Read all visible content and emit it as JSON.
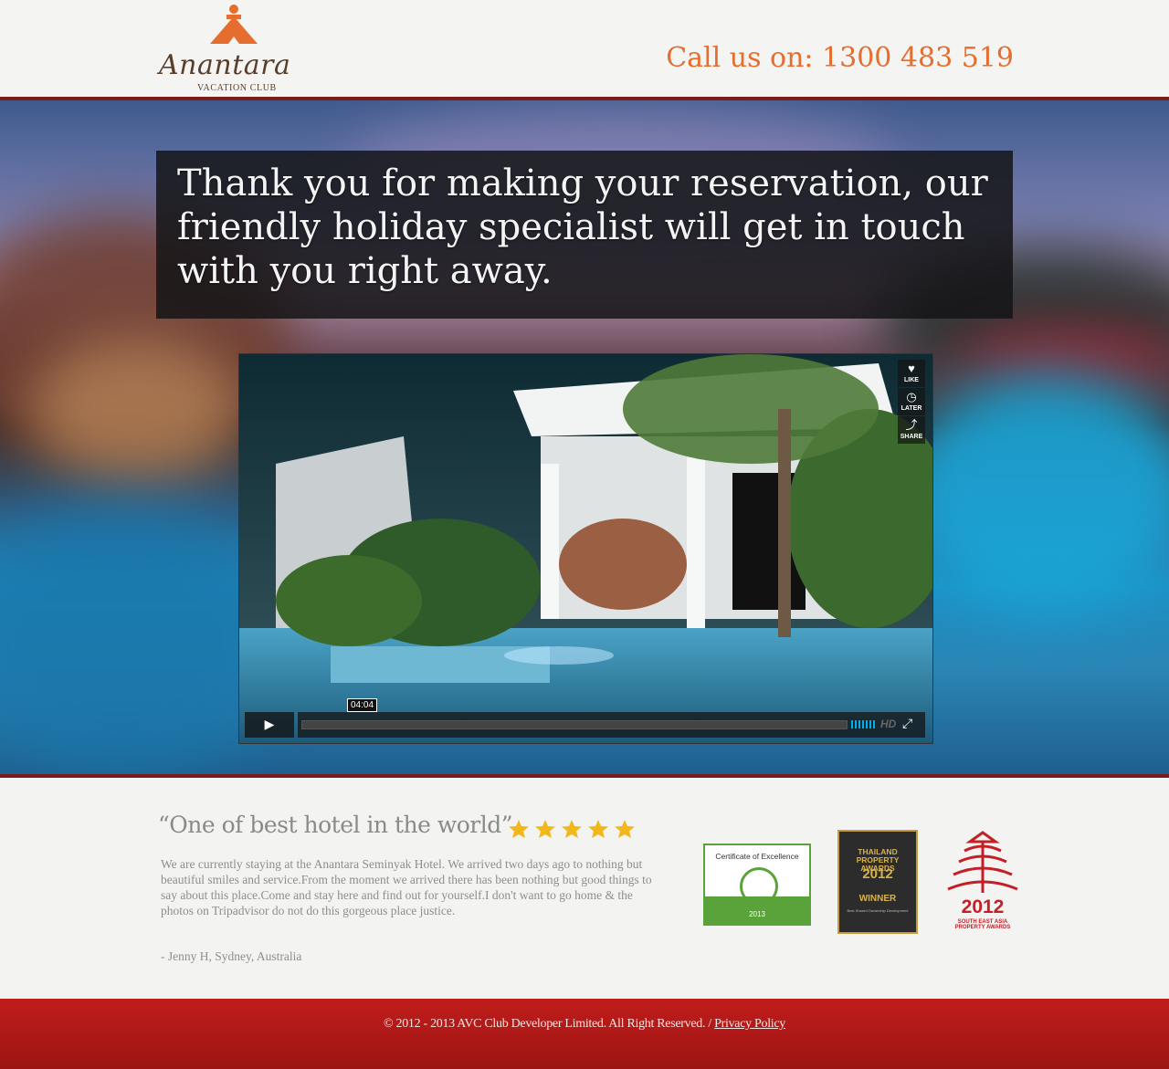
{
  "brand": {
    "name": "Anantara",
    "subtitle": "VACATION CLUB",
    "accent": "#e56d2d"
  },
  "header": {
    "call_label": "Call us on:",
    "phone": "1300 483 519"
  },
  "hero": {
    "message": "Thank you for making your reservation, our friendly holiday specialist will get in touch with you right away."
  },
  "video": {
    "side_buttons": [
      {
        "label": "LIKE",
        "icon": "heart-icon"
      },
      {
        "label": "LATER",
        "icon": "clock-icon"
      },
      {
        "label": "SHARE",
        "icon": "share-icon"
      }
    ],
    "timestamp": "04:04",
    "quality": "HD"
  },
  "testimonial": {
    "quote": "“One of  best hotel in the world”",
    "rating": 5,
    "body": "We are currently staying at the Anantara Seminyak Hotel. We arrived two days ago to nothing but beautiful smiles and service.From the moment we arrived there has been nothing but good things to say about this place.Come and stay here and find out for yourself.I don't want to go home & the photos on Tripadvisor do not do this gorgeous place justice.",
    "author": "- Jenny H, Sydney, Australia"
  },
  "awards": {
    "tripadvisor": {
      "title": "Certificate of Excellence",
      "year": "2013"
    },
    "thailand": {
      "line1": "THAILAND PROPERTY AWARDS",
      "year": "2012",
      "result": "WINNER",
      "category": "Best Shared Ownership Development"
    },
    "sea": {
      "year": "2012",
      "caption": "SOUTH EAST ASIA PROPERTY AWARDS"
    }
  },
  "footer": {
    "copyright": "© 2012 - 2013 AVC Club Developer Limited. All Right Reserved. /",
    "privacy_link": "Privacy Policy"
  }
}
